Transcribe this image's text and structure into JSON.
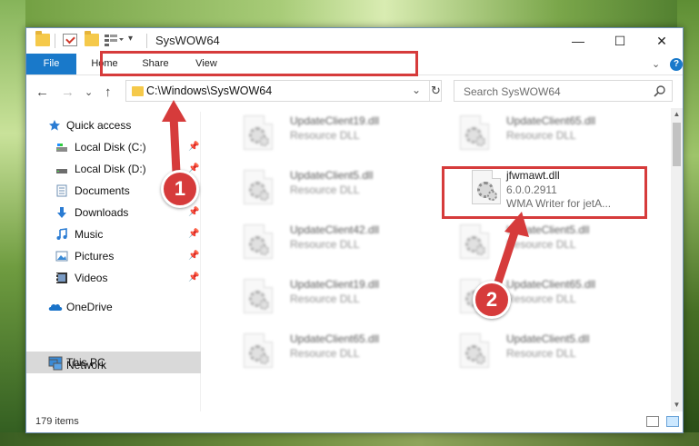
{
  "window": {
    "title": "SysWOW64",
    "minimize": "—",
    "maximize": "☐",
    "close": "✕"
  },
  "ribbon": {
    "tabs": [
      "File",
      "Home",
      "Share",
      "View"
    ],
    "expand": "⌄",
    "help": "?"
  },
  "nav": {
    "back": "←",
    "forward": "→",
    "recent": "⌄",
    "up": "↑",
    "address": "C:\\Windows\\SysWOW64",
    "address_dropdown": "⌄",
    "refresh": "↻",
    "search_placeholder": "Search SysWOW64"
  },
  "sidebar": {
    "items": [
      {
        "label": "Quick access",
        "icon": "star-icon",
        "pinned": false
      },
      {
        "label": "Local Disk (C:)",
        "icon": "drive-icon",
        "pinned": true
      },
      {
        "label": "Local Disk (D:)",
        "icon": "drive-icon",
        "pinned": true
      },
      {
        "label": "Documents",
        "icon": "documents-icon",
        "pinned": true
      },
      {
        "label": "Downloads",
        "icon": "download-icon",
        "pinned": true
      },
      {
        "label": "Music",
        "icon": "music-icon",
        "pinned": true
      },
      {
        "label": "Pictures",
        "icon": "pictures-icon",
        "pinned": true
      },
      {
        "label": "Videos",
        "icon": "videos-icon",
        "pinned": true
      },
      {
        "label": "OneDrive",
        "icon": "cloud-icon",
        "pinned": false
      },
      {
        "label": "This PC",
        "icon": "computer-icon",
        "pinned": false
      },
      {
        "label": "Network",
        "icon": "network-icon",
        "pinned": false
      }
    ]
  },
  "files": [
    {
      "name": "UpdateClient19.dll",
      "line1": "Resource DLL",
      "line2": ""
    },
    {
      "name": "UpdateClient65.dll",
      "line1": "Resource DLL",
      "line2": ""
    },
    {
      "name": "UpdateClient5.dll",
      "line1": "Resource DLL",
      "line2": ""
    },
    {
      "name": "jfwmawt.dll",
      "line1": "6.0.0.2911",
      "line2": "WMA Writer for jetA..."
    },
    {
      "name": "UpdateClient42.dll",
      "line1": "Resource DLL",
      "line2": ""
    },
    {
      "name": "UpdateClient5.dll",
      "line1": "Resource DLL",
      "line2": ""
    },
    {
      "name": "UpdateClient19.dll",
      "line1": "Resource DLL",
      "line2": ""
    },
    {
      "name": "UpdateClient65.dll",
      "line1": "Resource DLL",
      "line2": ""
    },
    {
      "name": "UpdateClient65.dll",
      "line1": "Resource DLL",
      "line2": ""
    },
    {
      "name": "UpdateClient5.dll",
      "line1": "Resource DLL",
      "line2": ""
    }
  ],
  "status": {
    "item_count": "179 items"
  },
  "callouts": [
    "1",
    "2"
  ],
  "colors": {
    "accent": "#1979ca",
    "highlight": "#d63b3b",
    "folder": "#f5c94a"
  }
}
